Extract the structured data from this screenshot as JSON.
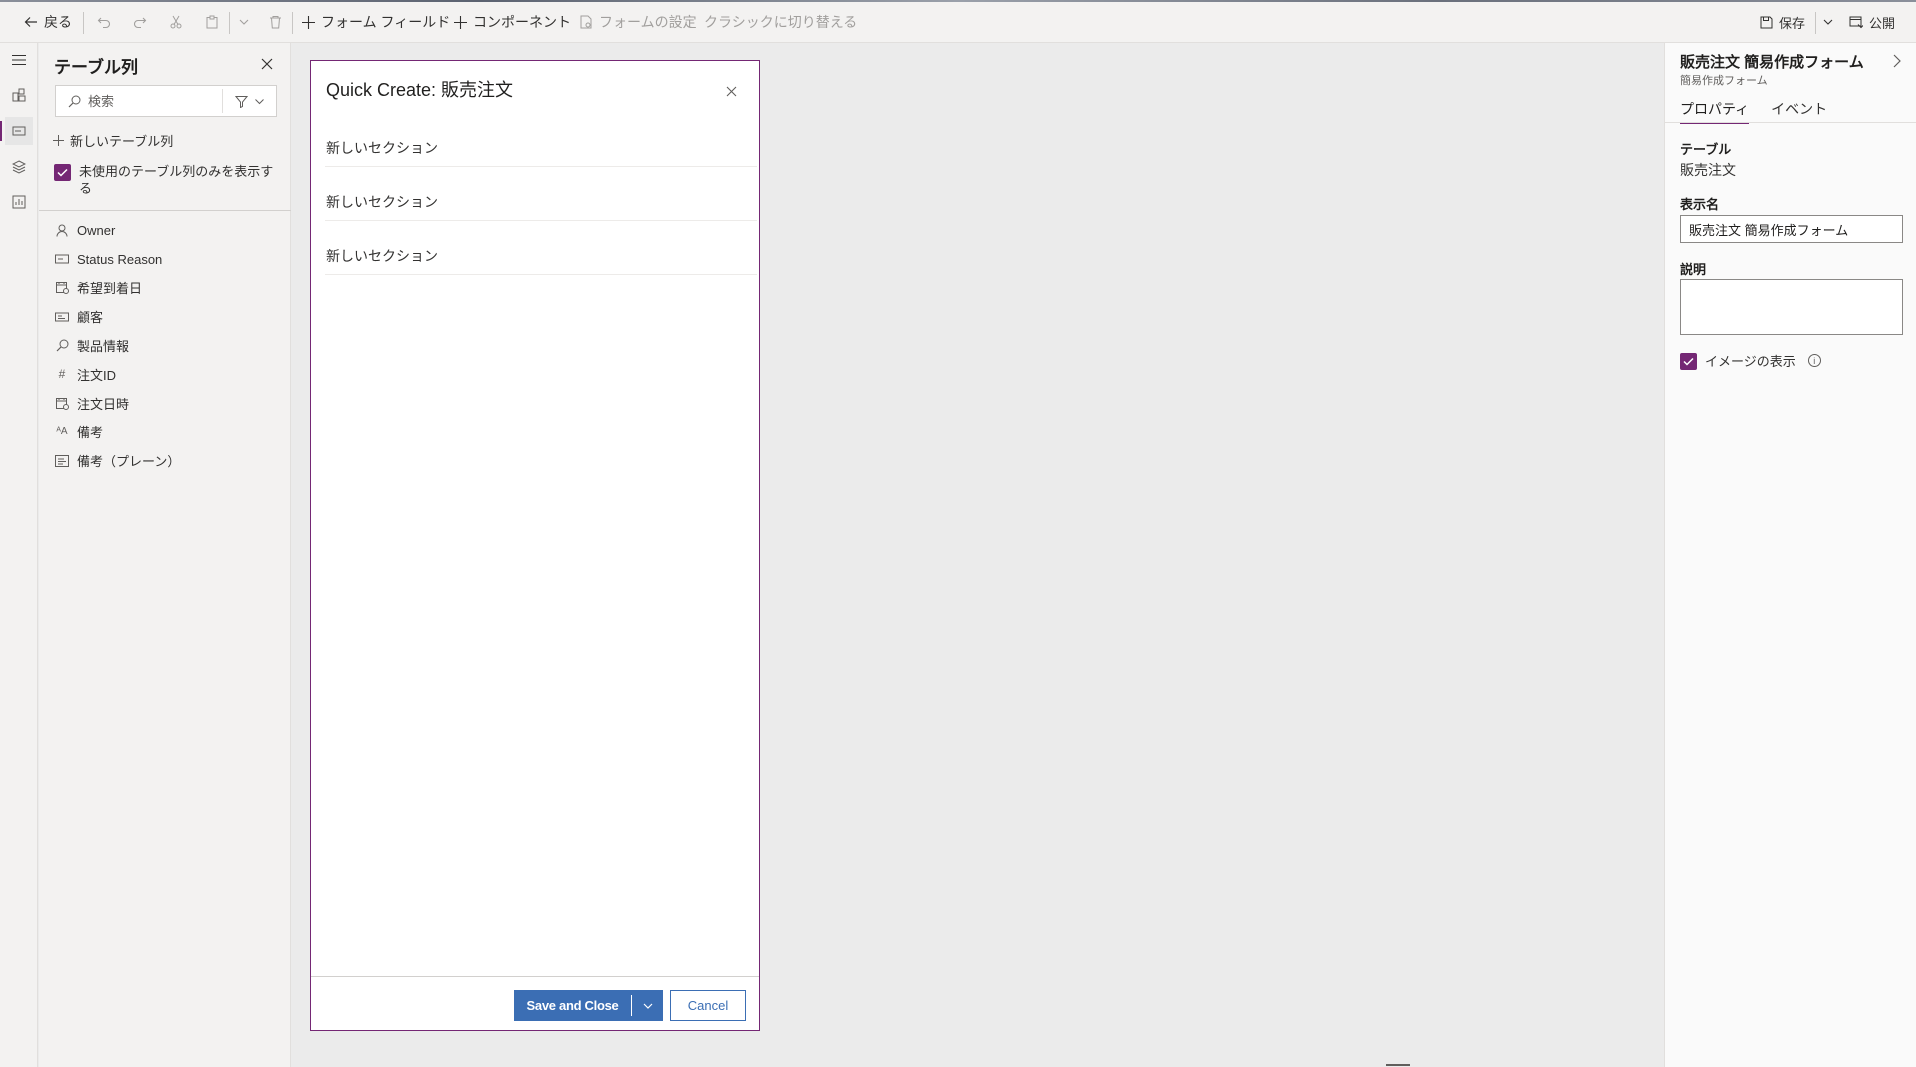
{
  "toolbar": {
    "back_label": "戻る",
    "form_field_label": "フォーム フィールド",
    "component_label": "コンポーネント",
    "form_settings_label": "フォームの設定",
    "classic_label": "クラシックに切り替える",
    "save_label": "保存",
    "publish_label": "公開"
  },
  "columns_pane": {
    "title": "テーブル列",
    "search_placeholder": "検索",
    "new_column_label": "新しいテーブル列",
    "unused_only_label": "未使用のテーブル列のみを表示する",
    "unused_only_checked": true,
    "fields": [
      {
        "label": "Owner",
        "icon": "person-icon"
      },
      {
        "label": "Status Reason",
        "icon": "option-set-icon"
      },
      {
        "label": "希望到着日",
        "icon": "calendar-icon"
      },
      {
        "label": "顧客",
        "icon": "text-field-icon"
      },
      {
        "label": "製品情報",
        "icon": "lookup-icon"
      },
      {
        "label": "注文ID",
        "icon": "number-icon"
      },
      {
        "label": "注文日時",
        "icon": "calendar-icon"
      },
      {
        "label": "備考",
        "icon": "rich-text-icon"
      },
      {
        "label": "備考（プレーン）",
        "icon": "multiline-text-icon"
      }
    ]
  },
  "form": {
    "title": "Quick Create: 販売注文",
    "sections": [
      {
        "label": "新しいセクション"
      },
      {
        "label": "新しいセクション"
      },
      {
        "label": "新しいセクション"
      }
    ],
    "save_close_label": "Save and Close",
    "cancel_label": "Cancel"
  },
  "properties": {
    "title": "販売注文 簡易作成フォーム",
    "subtitle": "簡易作成フォーム",
    "tabs": [
      {
        "label": "プロパティ",
        "active": true
      },
      {
        "label": "イベント",
        "active": false
      }
    ],
    "table_label": "テーブル",
    "table_value": "販売注文",
    "display_name_label": "表示名",
    "display_name_value": "販売注文 簡易作成フォーム",
    "description_label": "説明",
    "description_value": "",
    "show_image_label": "イメージの表示",
    "show_image_checked": true
  },
  "colors": {
    "accent": "#742774",
    "primary_button": "#3b6eb4"
  }
}
